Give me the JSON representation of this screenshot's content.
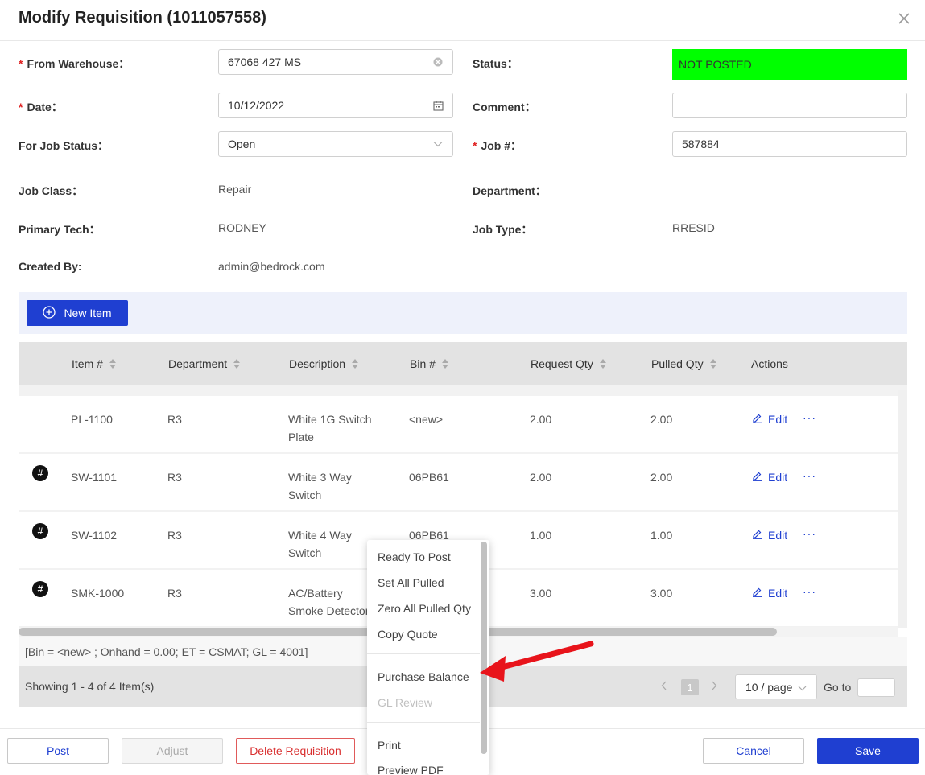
{
  "title": "Modify Requisition (1011057558)",
  "form": {
    "from_warehouse_label": "From Warehouse",
    "from_warehouse_value": "67068 427 MS",
    "status_label": "Status",
    "status_value": "NOT POSTED",
    "status_color": "#00ff00",
    "date_label": "Date",
    "date_value": "10/12/2022",
    "comment_label": "Comment",
    "comment_value": "",
    "job_status_label": "For Job Status",
    "job_status_value": "Open",
    "job_no_label": "Job #",
    "job_no_value": "587884",
    "job_class_label": "Job Class",
    "job_class_value": "Repair",
    "department_label": "Department",
    "department_value": "",
    "primary_tech_label": "Primary Tech",
    "primary_tech_value": "RODNEY",
    "job_type_label": "Job Type",
    "job_type_value": "RRESID",
    "created_by_label": "Created By",
    "created_by_value": "admin@bedrock.com",
    "colon": "："
  },
  "toolbar": {
    "new_item_label": "New Item"
  },
  "table": {
    "columns": [
      "Item #",
      "Department",
      "Description",
      "Bin #",
      "Request Qty",
      "Pulled Qty",
      "Actions"
    ],
    "edit_label": "Edit",
    "more_label": "···",
    "hash_label": "#",
    "rows": [
      {
        "has_hash": false,
        "item": "PL-1100",
        "department": "R3",
        "description": "White 1G Switch Plate",
        "bin": "<new>",
        "request_qty": "2.00",
        "pulled_qty": "2.00"
      },
      {
        "has_hash": true,
        "item": "SW-1101",
        "department": "R3",
        "description": "White 3 Way Switch",
        "bin": "06PB61",
        "request_qty": "2.00",
        "pulled_qty": "2.00"
      },
      {
        "has_hash": true,
        "item": "SW-1102",
        "department": "R3",
        "description": "White 4 Way Switch",
        "bin": "06PB61",
        "request_qty": "1.00",
        "pulled_qty": "1.00"
      },
      {
        "has_hash": true,
        "item": "SMK-1000",
        "department": "R3",
        "description": "AC/Battery Smoke Detector",
        "bin": "",
        "request_qty": "3.00",
        "pulled_qty": "3.00"
      }
    ]
  },
  "footnote": "[Bin = <new> ; Onhand = 0.00; ET = CSMAT; GL = 4001]",
  "pagination": {
    "showing_text": "Showing 1 - 4 of 4 Item(s)",
    "current_page": "1",
    "page_size": "10 / page",
    "goto_label": "Go to",
    "goto_value": ""
  },
  "footer": {
    "post_label": "Post",
    "adjust_label": "Adjust",
    "delete_label": "Delete Requisition",
    "cancel_label": "Cancel",
    "save_label": "Save"
  },
  "menu": {
    "items": [
      "Ready To Post",
      "Set All Pulled",
      "Zero All Pulled Qty",
      "Copy Quote",
      "Purchase Balance",
      "GL Review",
      "Print",
      "Preview PDF"
    ]
  },
  "colors": {
    "primary": "#1f3fd1",
    "danger": "#d93030",
    "annotation_arrow": "#e8141b"
  }
}
